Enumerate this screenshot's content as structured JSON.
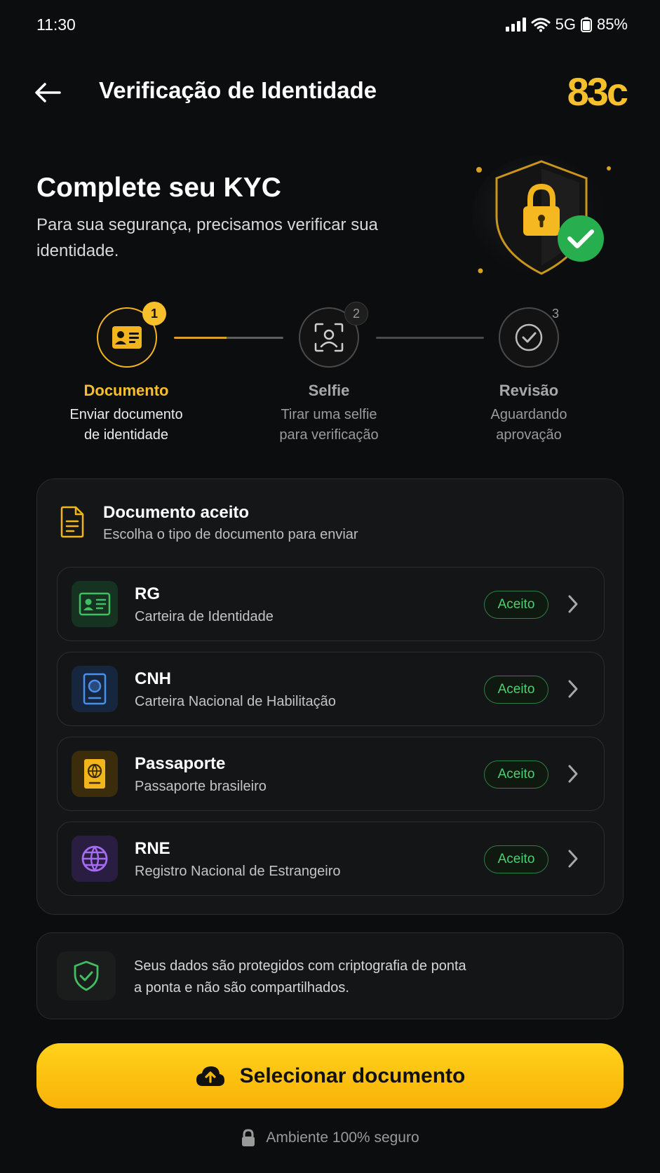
{
  "status_bar": {
    "time": "11:30",
    "network": "5G",
    "battery": "85%"
  },
  "header": {
    "title": "Verificação de Identidade",
    "brand": "83c",
    "back_icon": "arrow-left-icon"
  },
  "hero": {
    "title": "Complete seu KYC",
    "subtitle": "Para sua segurança, precisamos verificar sua identidade."
  },
  "stepper": {
    "steps": [
      {
        "number": "1",
        "name": "Documento",
        "desc_line1": "Enviar documento",
        "desc_line2": "de identidade",
        "icon": "id-card-icon",
        "state": "active"
      },
      {
        "number": "2",
        "name": "Selfie",
        "desc_line1": "Tirar uma selfie",
        "desc_line2": "para verificação",
        "icon": "face-scan-icon",
        "state": "pending"
      },
      {
        "number": "3",
        "name": "Revisão",
        "desc_line1": "Aguardando",
        "desc_line2": "aprovação",
        "icon": "check-circle-icon",
        "state": "pending"
      }
    ]
  },
  "documents": {
    "title": "Documento aceito",
    "subtitle": "Escolha o tipo de documento para enviar",
    "items": [
      {
        "name": "RG",
        "desc": "Carteira de Identidade",
        "badge": "Aceito",
        "icon": "id-card-icon",
        "color": "#3fbf62"
      },
      {
        "name": "CNH",
        "desc": "Carteira Nacional de Habilitação",
        "badge": "Aceito",
        "icon": "license-icon",
        "color": "#4a8fe8"
      },
      {
        "name": "Passaporte",
        "desc": "Passaporte brasileiro",
        "badge": "Aceito",
        "icon": "passport-icon",
        "color": "#f2b51c"
      },
      {
        "name": "RNE",
        "desc": "Registro Nacional de Estrangeiro",
        "badge": "Aceito",
        "icon": "globe-icon",
        "color": "#a56cf0"
      }
    ]
  },
  "notice": {
    "line1": "Seus dados são protegidos com criptografia de ponta",
    "line2": "a ponta e não são compartilhados."
  },
  "cta": {
    "label": "Selecionar documento",
    "icon": "cloud-upload-icon"
  },
  "footer": {
    "text": "Ambiente 100% seguro",
    "icon": "lock-icon"
  },
  "colors": {
    "accent": "#f6c02b",
    "success": "#4ccf74",
    "background": "#0c0d0f"
  }
}
